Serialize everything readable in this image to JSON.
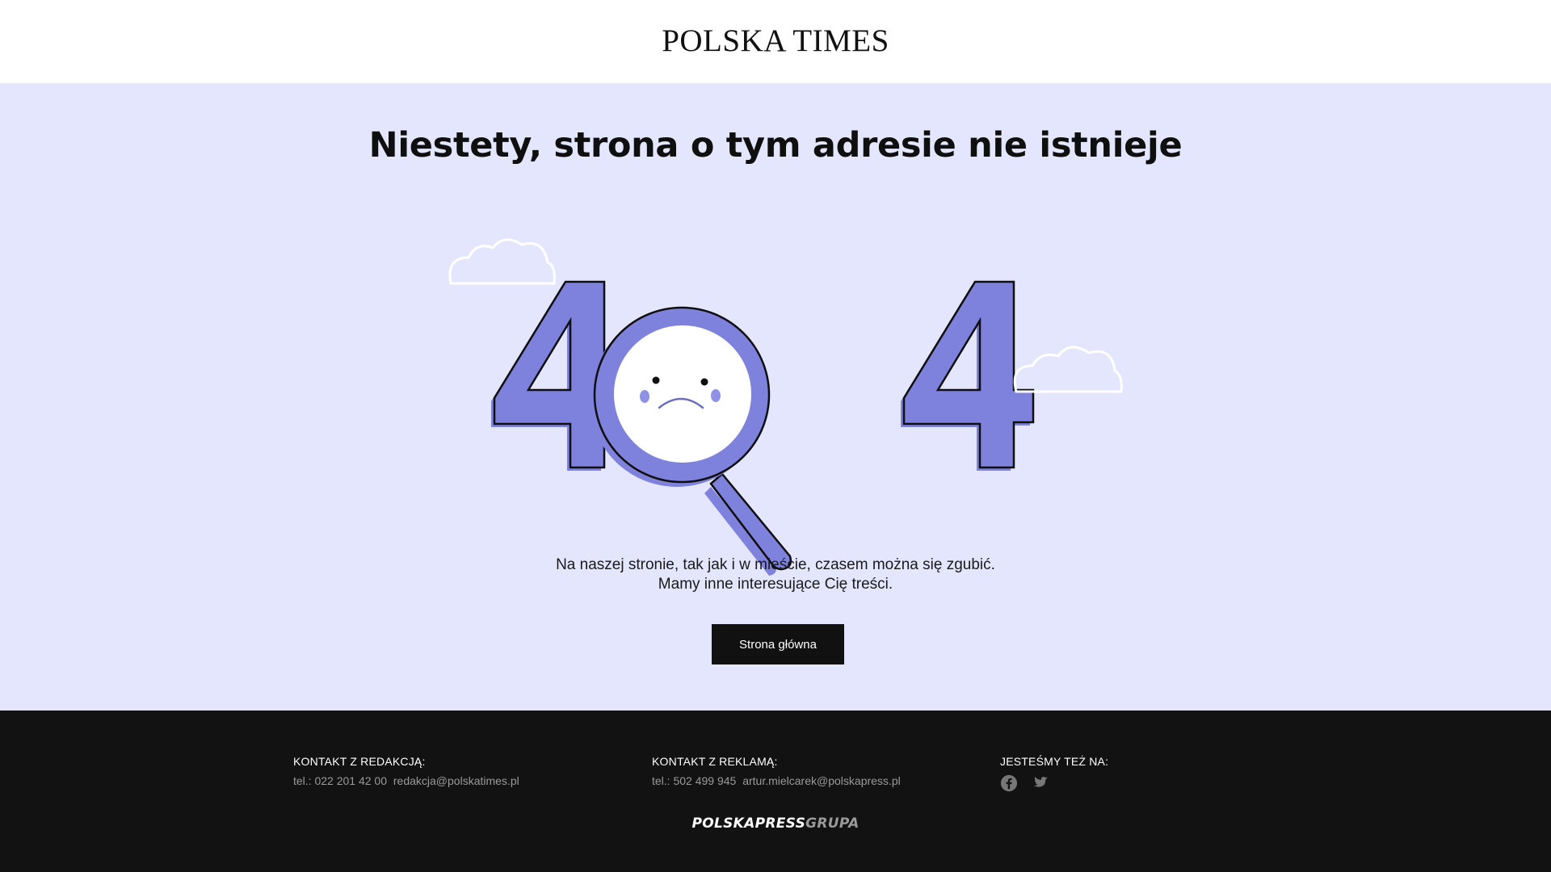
{
  "header": {
    "logo_text": "POLSKA TIMES"
  },
  "main": {
    "headline": "Niestety, strona o tym adresie nie istnieje",
    "message_line1": "Na naszej stronie, tak jak i w mieście, czasem można się zgubić.",
    "message_line2": "Mamy inne interesujące Cię treści.",
    "home_button_label": "Strona główna"
  },
  "illustration": {
    "icons": [
      "cloud-icon",
      "magnifier-sad-face-icon",
      "cloud-icon"
    ],
    "accent_color": "#7f82dc",
    "background_color": "#e3e6fd"
  },
  "footer": {
    "editorial": {
      "title": "KONTAKT Z REDAKCJĄ:",
      "phone": "tel.: 022 201 42 00",
      "email": "redakcja@polskatimes.pl"
    },
    "advertising": {
      "title": "KONTAKT Z REKLAMĄ:",
      "phone": "tel.: 502 499 945",
      "email": "artur.mielcarek@polskapress.pl"
    },
    "social": {
      "title": "JESTEŚMY TEŻ NA:",
      "icons": [
        "facebook-icon",
        "twitter-icon"
      ]
    },
    "brand_part1": "POLSKAPRESS",
    "brand_part2": "GRUPA"
  },
  "colors": {
    "page_bg": "#e3e6fd",
    "footer_bg": "#121212",
    "button_bg": "#111111",
    "accent": "#7f82dc"
  }
}
